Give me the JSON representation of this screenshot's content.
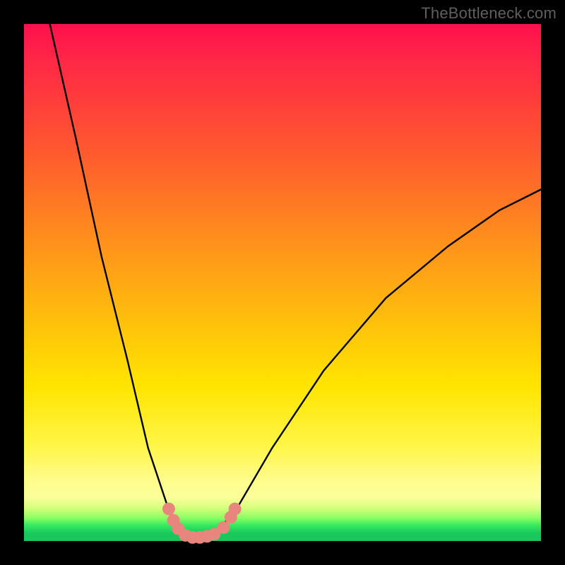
{
  "watermark": "TheBottleneck.com",
  "chart_data": {
    "type": "line",
    "title": "",
    "xlabel": "",
    "ylabel": "",
    "x_range": [
      0,
      100
    ],
    "y_range": [
      0,
      100
    ],
    "curve": {
      "name": "bottleneck-curve",
      "color": "#000000",
      "points": [
        {
          "x": 5,
          "y": 100
        },
        {
          "x": 10,
          "y": 78
        },
        {
          "x": 15,
          "y": 55
        },
        {
          "x": 20,
          "y": 35
        },
        {
          "x": 24,
          "y": 18
        },
        {
          "x": 28,
          "y": 6
        },
        {
          "x": 31,
          "y": 1.5
        },
        {
          "x": 34,
          "y": 0.7
        },
        {
          "x": 37,
          "y": 1.5
        },
        {
          "x": 41,
          "y": 6
        },
        {
          "x": 48,
          "y": 18
        },
        {
          "x": 58,
          "y": 33
        },
        {
          "x": 70,
          "y": 47
        },
        {
          "x": 82,
          "y": 57
        },
        {
          "x": 92,
          "y": 64
        },
        {
          "x": 100,
          "y": 68
        }
      ]
    },
    "markers": {
      "name": "highlight-dots",
      "color": "#e8857c",
      "points": [
        {
          "x": 28.0,
          "y": 6.2
        },
        {
          "x": 28.9,
          "y": 4.0
        },
        {
          "x": 29.8,
          "y": 2.4
        },
        {
          "x": 31.2,
          "y": 1.1
        },
        {
          "x": 32.6,
          "y": 0.7
        },
        {
          "x": 34.0,
          "y": 0.7
        },
        {
          "x": 35.4,
          "y": 0.9
        },
        {
          "x": 36.8,
          "y": 1.3
        },
        {
          "x": 38.6,
          "y": 2.6
        },
        {
          "x": 40.0,
          "y": 4.6
        },
        {
          "x": 40.8,
          "y": 6.2
        }
      ]
    }
  }
}
